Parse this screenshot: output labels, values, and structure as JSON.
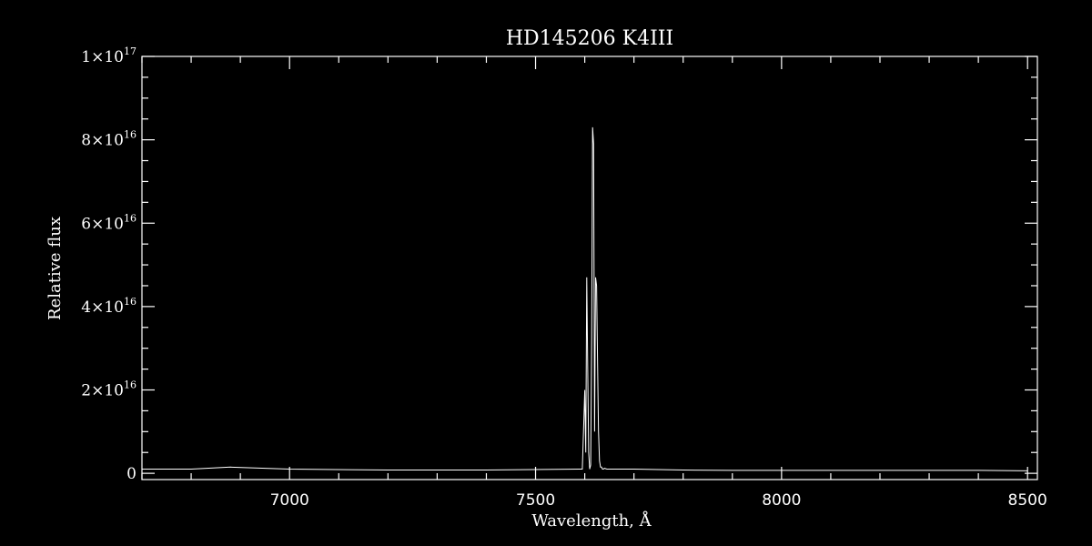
{
  "chart_data": {
    "type": "line",
    "title": "HD145206   K4III",
    "xlabel": "Wavelength, Å",
    "ylabel": "Relative flux",
    "xlim": [
      6700,
      8520
    ],
    "ylim": [
      -1500000000000000.0,
      1e+17
    ],
    "x_ticks": [
      {
        "value": 7000,
        "label": "7000"
      },
      {
        "value": 7500,
        "label": "7500"
      },
      {
        "value": 8000,
        "label": "8000"
      },
      {
        "value": 8500,
        "label": "8500"
      }
    ],
    "y_ticks": [
      {
        "value": 0,
        "mantissa": "0",
        "exponent": ""
      },
      {
        "value": 2e+16,
        "mantissa": "2×10",
        "exponent": "16"
      },
      {
        "value": 4e+16,
        "mantissa": "4×10",
        "exponent": "16"
      },
      {
        "value": 6e+16,
        "mantissa": "6×10",
        "exponent": "16"
      },
      {
        "value": 8e+16,
        "mantissa": "8×10",
        "exponent": "16"
      },
      {
        "value": 1e+17,
        "mantissa": "1×10",
        "exponent": "17"
      }
    ],
    "x_minor_step": 100,
    "y_minor_step": 5000000000000000.0,
    "grid": false,
    "colors": {
      "background": "#000000",
      "foreground": "#ffffff"
    },
    "series": [
      {
        "x": [
          6700,
          6800,
          6880,
          7000,
          7200,
          7400,
          7595,
          7598,
          7600,
          7602,
          7604,
          7606,
          7608,
          7610,
          7612,
          7614,
          7616,
          7618,
          7620,
          7622,
          7624,
          7626,
          7628,
          7630,
          7632,
          7634,
          7636,
          7638,
          7640,
          7645,
          7650,
          7700,
          7800,
          7900,
          8000,
          8200,
          8400,
          8500
        ],
        "y": [
          1000000000000000.0,
          1000000000000000.0,
          1500000000000000.0,
          1000000000000000.0,
          800000000000000.0,
          800000000000000.0,
          1000000000000000.0,
          1.2e+16,
          2e+16,
          5000000000000000.0,
          4.7e+16,
          2.6e+16,
          5000000000000000.0,
          1000000000000000.0,
          2000000000000000.0,
          3.3e+16,
          8.3e+16,
          7.9e+16,
          1e+16,
          4.7e+16,
          4.5e+16,
          2.6e+16,
          1e+16,
          3000000000000000.0,
          1500000000000000.0,
          1500000000000000.0,
          1000000000000000.0,
          1000000000000000.0,
          1200000000000000.0,
          1000000000000000.0,
          1000000000000000.0,
          1000000000000000.0,
          800000000000000.0,
          700000000000000.0,
          700000000000000.0,
          700000000000000.0,
          700000000000000.0,
          600000000000000.0
        ]
      }
    ]
  }
}
